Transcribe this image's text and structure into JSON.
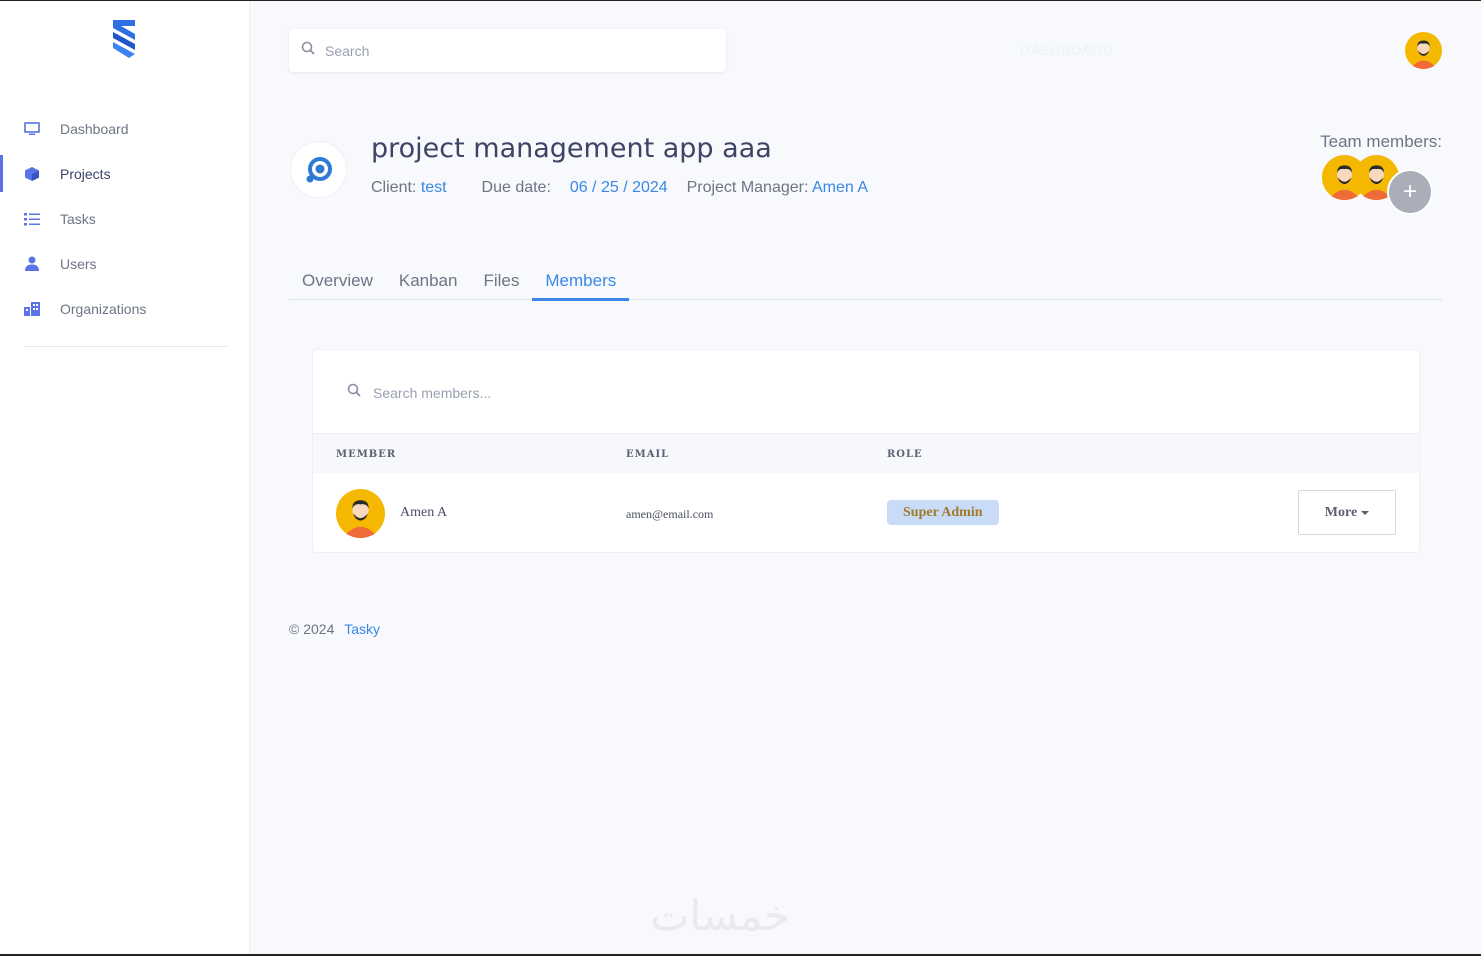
{
  "sidebar": {
    "logo_icon": "stacked-layers-logo",
    "items": [
      {
        "label": "Dashboard",
        "icon": "monitor-icon"
      },
      {
        "label": "Projects",
        "icon": "cube-icon",
        "active": true
      },
      {
        "label": "Tasks",
        "icon": "list-icon"
      },
      {
        "label": "Users",
        "icon": "user-icon"
      },
      {
        "label": "Organizations",
        "icon": "building-icon"
      }
    ]
  },
  "header": {
    "search_placeholder": "Search",
    "title": "DASHBOARD"
  },
  "project": {
    "title": "project management app aaa",
    "client_label": "Client:",
    "client": "test",
    "due_label": "Due date:",
    "due_date": "06 / 25 / 2024",
    "manager_label": "Project Manager:",
    "manager": "Amen A",
    "team_label": "Team members:",
    "add_symbol": "+"
  },
  "tabs": [
    {
      "label": "Overview"
    },
    {
      "label": "Kanban"
    },
    {
      "label": "Files"
    },
    {
      "label": "Members",
      "active": true
    }
  ],
  "members": {
    "search_placeholder": "Search members...",
    "columns": [
      "MEMBER",
      "EMAIL",
      "ROLE"
    ],
    "rows": [
      {
        "name": "Amen A",
        "email": "amen@email.com",
        "role": "Super Admin",
        "action": "More"
      }
    ]
  },
  "footer": {
    "copyright": "© 2024",
    "brand": "Tasky"
  },
  "watermark": "خمسات",
  "colors": {
    "accent": "#3a87e8",
    "sidebar_active": "#5a73e8",
    "badge_bg": "#c9dcf7",
    "badge_text": "#a07a2c",
    "avatar_bg": "#f5b800"
  }
}
